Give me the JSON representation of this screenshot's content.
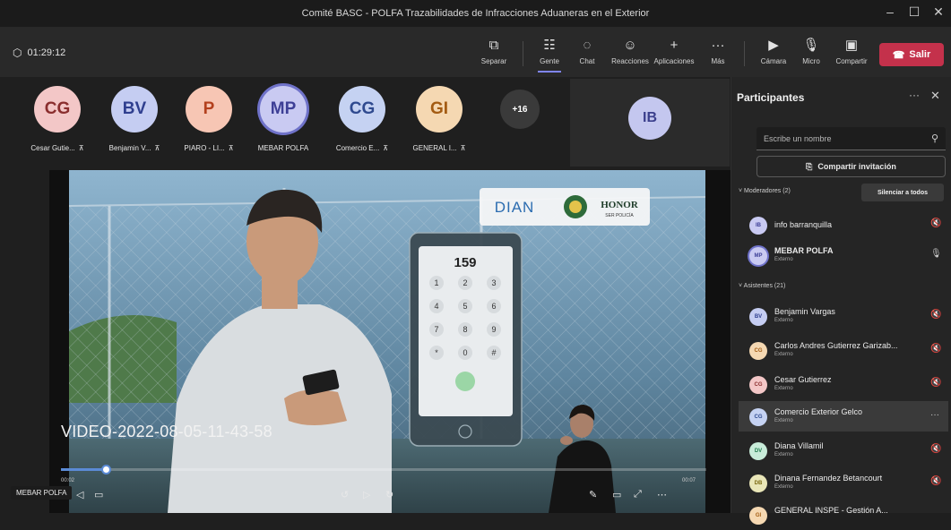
{
  "window": {
    "title": "Comité BASC - POLFA Trazabilidades de Infracciones Aduaneras en el Exterior",
    "minimize": "–",
    "maximize": "☐",
    "close": "✕"
  },
  "toolbar": {
    "timer": "01:29:12",
    "buttons": [
      {
        "label": "Separar",
        "icon": "⧉"
      },
      {
        "label": "Gente",
        "icon": "☷"
      },
      {
        "label": "Chat",
        "icon": "◌"
      },
      {
        "label": "Reacciones",
        "icon": "☺"
      },
      {
        "label": "Aplicaciones",
        "icon": "+"
      },
      {
        "label": "Más",
        "icon": "···"
      },
      {
        "label": "Cámara",
        "icon": "▶"
      },
      {
        "label": "Micro",
        "icon": "🎙"
      },
      {
        "label": "Compartir",
        "icon": "▣"
      }
    ],
    "leave_label": "Salir",
    "leave_icon": "☎"
  },
  "gallery": {
    "tiles": [
      {
        "initials": "CG",
        "name": "Cesar Gutie...",
        "bg": "#f3c7c7",
        "fg": "#8a2e2e"
      },
      {
        "initials": "BV",
        "name": "Benjamin V...",
        "bg": "#c5cdf2",
        "fg": "#2f3f8f"
      },
      {
        "initials": "P",
        "name": "PIARO - LI...",
        "bg": "#f7c6b4",
        "fg": "#b3401d"
      },
      {
        "initials": "MP",
        "name": "MEBAR POLFA",
        "bg": "#c9caf2",
        "fg": "#3d3f96"
      },
      {
        "initials": "CG",
        "name": "Comercio E...",
        "bg": "#c5d2f2",
        "fg": "#2f4a8f"
      },
      {
        "initials": "GI",
        "name": "GENERAL I...",
        "bg": "#f5d8b2",
        "fg": "#a35b12"
      },
      {
        "initials": "+16",
        "name": "",
        "bg": "#3a3a3a",
        "fg": "#ffffff"
      }
    ],
    "spotlight_initials": "IB"
  },
  "video": {
    "title": "VIDEO-2022-08-05-11-43-58",
    "phone_number": "159",
    "logo_text": "DIAN",
    "badge_text": "HONOR",
    "badge_sub": "SER POLICÍA",
    "time_elapsed": "00:02",
    "time_total": "00:07",
    "progress": 0.07,
    "presenter_tag": "MEBAR POLFA"
  },
  "panel": {
    "title": "Participantes",
    "search_placeholder": "Escribe un nombre",
    "invite_label": "Compartir invitación",
    "moderators_label": "Moderadores (2)",
    "mute_all_label": "Silenciar a todos",
    "attendees_label": "Asistentes (21)",
    "moderators": [
      {
        "initials": "IB",
        "name": "info barranquilla",
        "sub": "",
        "bg": "#c9caf2",
        "fg": "#3d3f96",
        "status": "🔇"
      },
      {
        "initials": "MP",
        "name": "MEBAR POLFA",
        "sub": "Externo",
        "bg": "#c9caf2",
        "fg": "#3d3f96",
        "status": "🎙"
      }
    ],
    "attendees": [
      {
        "initials": "BV",
        "name": "Benjamin Vargas",
        "sub": "Externo",
        "bg": "#c5cdf2",
        "fg": "#2f3f8f",
        "status": "🔇"
      },
      {
        "initials": "CG",
        "name": "Carlos Andres Gutierrez Garizab...",
        "sub": "Externo",
        "bg": "#f5d8b2",
        "fg": "#a35b12",
        "status": "🔇"
      },
      {
        "initials": "CG",
        "name": "Cesar Gutierrez",
        "sub": "Externo",
        "bg": "#f3c7c7",
        "fg": "#8a2e2e",
        "status": "🔇"
      },
      {
        "initials": "CG",
        "name": "Comercio Exterior Gelco",
        "sub": "Externo",
        "bg": "#c5d2f2",
        "fg": "#2f4a8f",
        "status": "···"
      },
      {
        "initials": "DV",
        "name": "Diana Villamil",
        "sub": "Externo",
        "bg": "#c8ecd9",
        "fg": "#1f7a4d",
        "status": "🔇"
      },
      {
        "initials": "DB",
        "name": "Dinana Fernandez Betancourt",
        "sub": "Externo",
        "bg": "#e9e6b8",
        "fg": "#7a6a12",
        "status": "🔇"
      },
      {
        "initials": "GI",
        "name": "GENERAL INSPE - Gestión A...",
        "sub": "",
        "bg": "#f5d8b2",
        "fg": "#a35b12",
        "status": ""
      }
    ]
  }
}
